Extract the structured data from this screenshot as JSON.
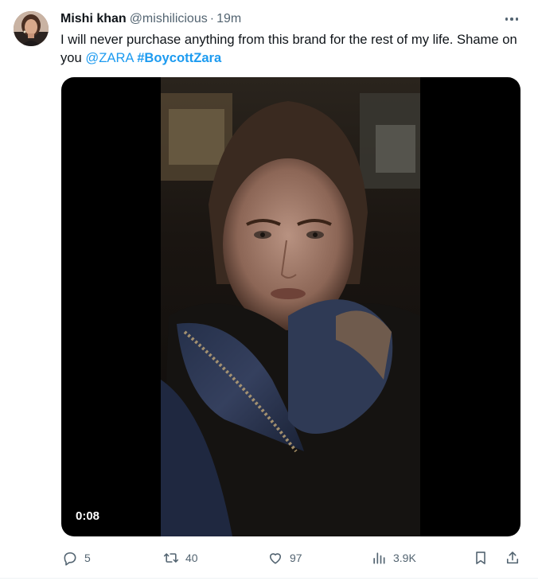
{
  "tweet": {
    "display_name": "Mishi khan",
    "handle": "@mishilicious",
    "separator": "·",
    "time": "19m",
    "text_plain": "I will never purchase anything from this brand for the rest of my life. Shame on you",
    "mention": "@ZARA",
    "hashtag": "#BoycottZara"
  },
  "media": {
    "type": "video",
    "duration": "0:08"
  },
  "actions": {
    "replies": "5",
    "reposts": "40",
    "likes": "97",
    "views": "3.9K"
  },
  "colors": {
    "link": "#1d9bf0",
    "text": "#0f1419",
    "muted": "#536471"
  },
  "icons": [
    "more-icon",
    "reply-icon",
    "repost-icon",
    "like-icon",
    "views-icon",
    "bookmark-icon",
    "share-icon"
  ]
}
